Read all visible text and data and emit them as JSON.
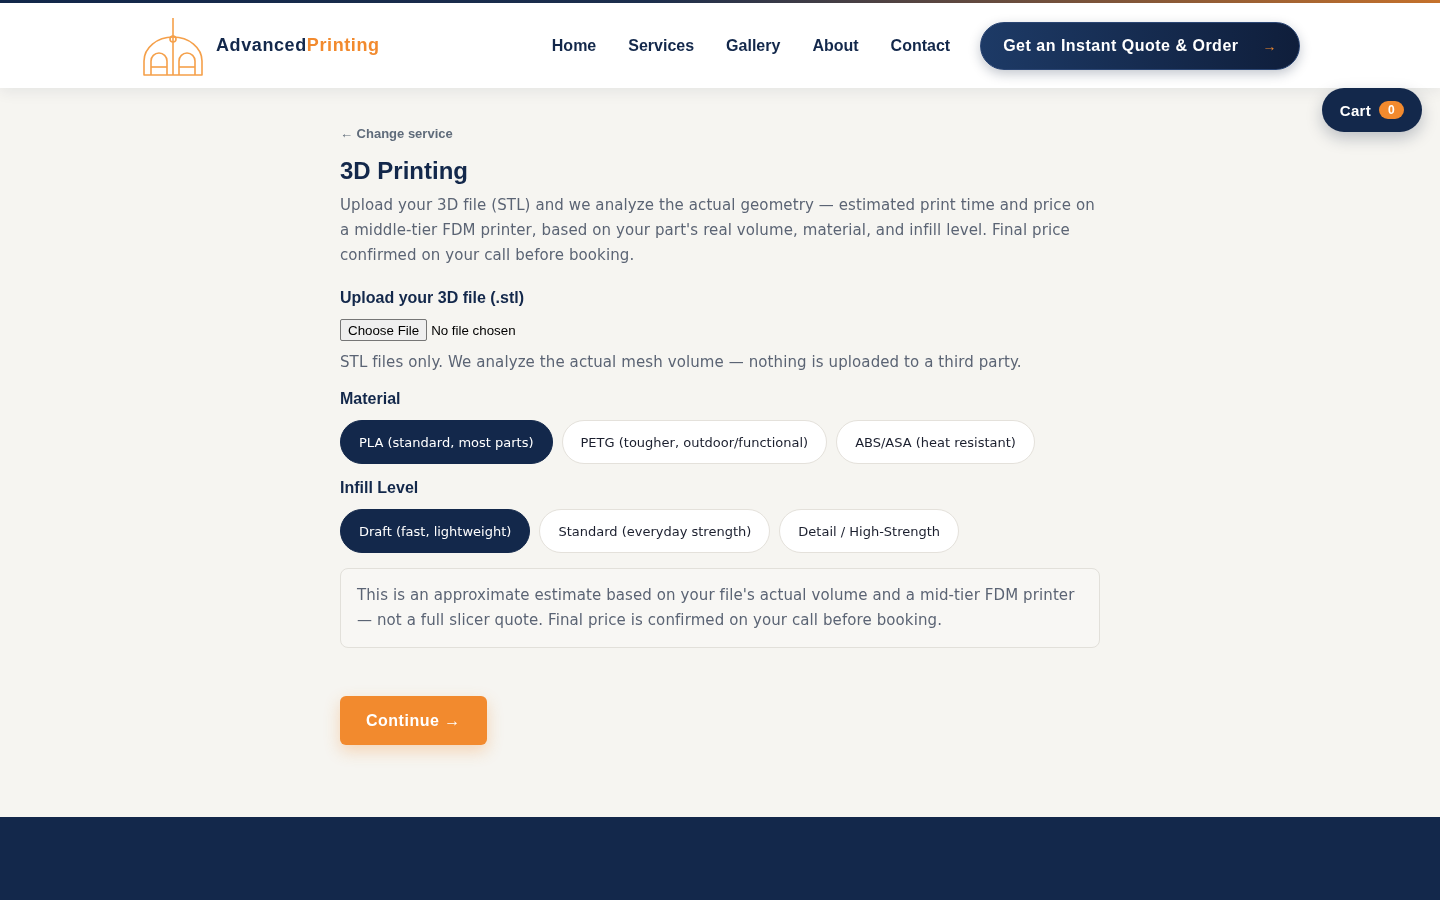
{
  "header": {
    "brand": {
      "first": "Advanced",
      "second": "Printing"
    },
    "nav": [
      {
        "label": "Home"
      },
      {
        "label": "Services"
      },
      {
        "label": "Gallery"
      },
      {
        "label": "About"
      },
      {
        "label": "Contact"
      }
    ],
    "cta": {
      "label": "Get an Instant Quote & Order",
      "arrow": "→"
    }
  },
  "cart": {
    "label": "Cart",
    "count": "0"
  },
  "back_link": "← Change service",
  "title": "3D Printing",
  "intro": "Upload your 3D file (STL) and we analyze the actual geometry — estimated print time and price on a middle-tier FDM printer, based on your part's real volume, material, and infill level. Final price confirmed on your call before booking.",
  "upload": {
    "label": "Upload your 3D file (.stl)",
    "button": "Choose File",
    "status": "No file chosen",
    "help": "STL files only. We analyze the actual mesh volume — nothing is uploaded to a third party."
  },
  "option_groups": [
    {
      "label": "Material",
      "options": [
        {
          "label": "PLA (standard, most parts)",
          "selected": true
        },
        {
          "label": "PETG (tougher, outdoor/functional)",
          "selected": false
        },
        {
          "label": "ABS/ASA (heat resistant)",
          "selected": false
        }
      ]
    },
    {
      "label": "Infill Level",
      "options": [
        {
          "label": "Draft (fast, lightweight)",
          "selected": true
        },
        {
          "label": "Standard (everyday strength)",
          "selected": false
        },
        {
          "label": "Detail / High-Strength",
          "selected": false
        }
      ]
    }
  ],
  "notice": "This is an approximate estimate based on your file's actual volume and a mid-tier FDM printer — not a full slicer quote. Final price is confirmed on your call before booking.",
  "continue_button": "Continue →"
}
